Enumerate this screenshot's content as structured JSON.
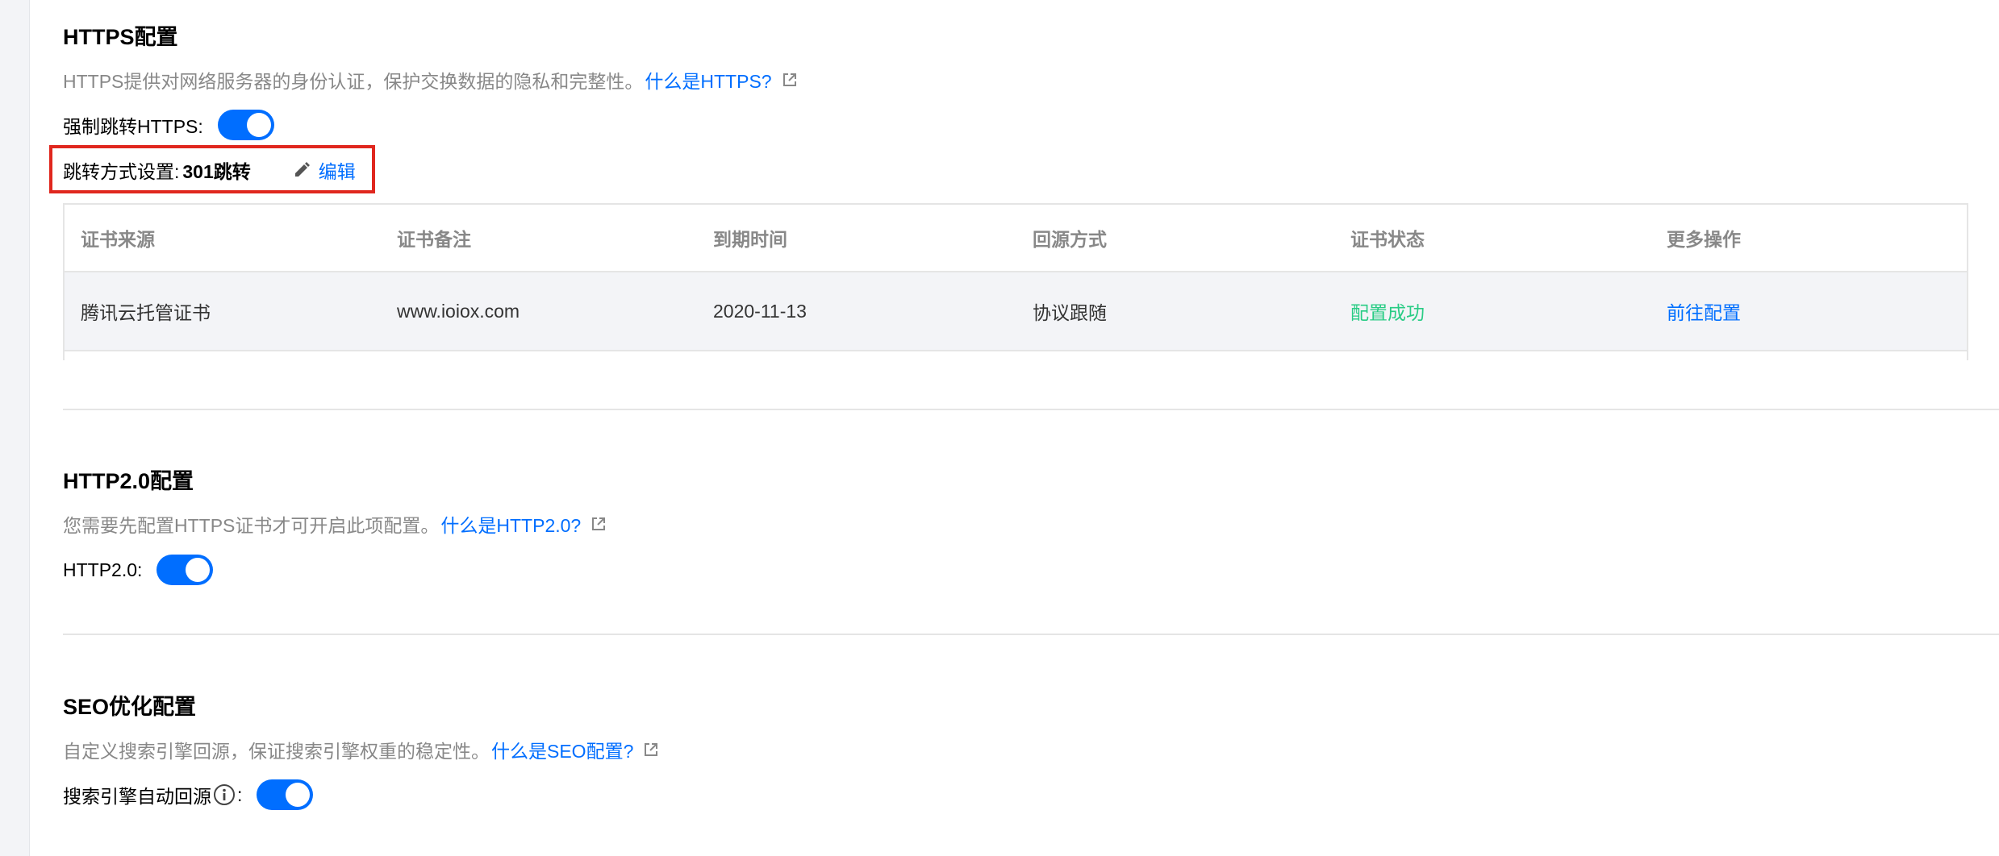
{
  "https": {
    "title": "HTTPS配置",
    "description": "HTTPS提供对网络服务器的身份认证，保护交换数据的隐私和完整性。",
    "help_link": "什么是HTTPS?",
    "force_label": "强制跳转HTTPS:",
    "force_enabled": true,
    "redirect_label": "跳转方式设置:",
    "redirect_value": "301跳转",
    "edit_label": "编辑",
    "table": {
      "columns": [
        "证书来源",
        "证书备注",
        "到期时间",
        "回源方式",
        "证书状态",
        "更多操作"
      ],
      "rows": [
        {
          "source": "腾讯云托管证书",
          "note": "www.ioiox.com",
          "expiry": "2020-11-13",
          "origin_mode": "协议跟随",
          "status": "配置成功",
          "action": "前往配置"
        }
      ]
    }
  },
  "http2": {
    "title": "HTTP2.0配置",
    "description": "您需要先配置HTTPS证书才可开启此项配置。",
    "help_link": "什么是HTTP2.0?",
    "toggle_label": "HTTP2.0:",
    "enabled": true
  },
  "seo": {
    "title": "SEO优化配置",
    "description": "自定义搜索引擎回源，保证搜索引擎权重的稳定性。",
    "help_link": "什么是SEO配置?",
    "toggle_label_prefix": "搜索引擎自动回源",
    "toggle_label_suffix": ":",
    "enabled": true
  },
  "colors": {
    "accent": "#006eff",
    "success": "#29cc85",
    "highlight": "#e0271e",
    "muted": "#888888"
  }
}
